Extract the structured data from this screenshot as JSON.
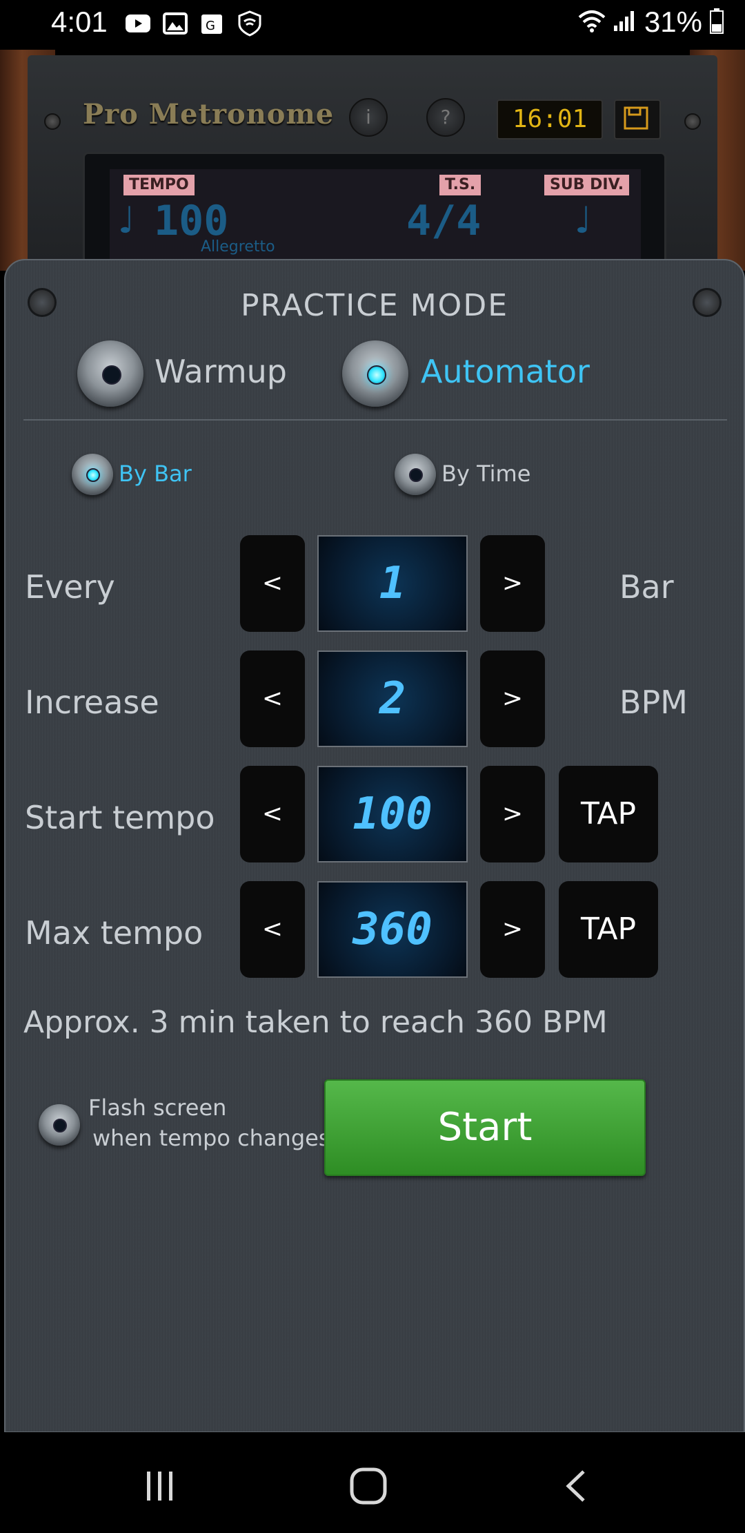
{
  "status_bar": {
    "time": "4:01",
    "battery": "31%",
    "icons": [
      "youtube-icon",
      "gallery-icon",
      "maps-icon",
      "shield-wifi-icon"
    ]
  },
  "metronome": {
    "brand": "Pro Metronome",
    "info_label": "i",
    "help_label": "?",
    "clock": "16:01",
    "tempo_tag": "TEMPO",
    "ts_tag": "T.S.",
    "subdiv_tag": "SUB DIV.",
    "tempo_value": "100",
    "tempo_name": "Allegretto",
    "time_signature": "4/4",
    "note_glyph": "♩"
  },
  "practice": {
    "title": "PRACTICE MODE",
    "modes": [
      {
        "label": "Warmup",
        "active": false
      },
      {
        "label": "Automator",
        "active": true
      }
    ],
    "by_options": [
      {
        "label": "By Bar",
        "active": true
      },
      {
        "label": "By Time",
        "active": false
      }
    ],
    "rows": [
      {
        "label": "Every",
        "value": "1",
        "unit": "Bar"
      },
      {
        "label": "Increase",
        "value": "2",
        "unit": "BPM"
      },
      {
        "label": "Start tempo",
        "value": "100",
        "tap": "TAP"
      },
      {
        "label": "Max tempo",
        "value": "360",
        "tap": "TAP"
      }
    ],
    "dec_label": "<",
    "inc_label": ">",
    "approx": "Approx. 3 min taken to reach 360 BPM",
    "flash_line1": "Flash screen",
    "flash_line2": "when tempo changes",
    "start_label": "Start"
  }
}
